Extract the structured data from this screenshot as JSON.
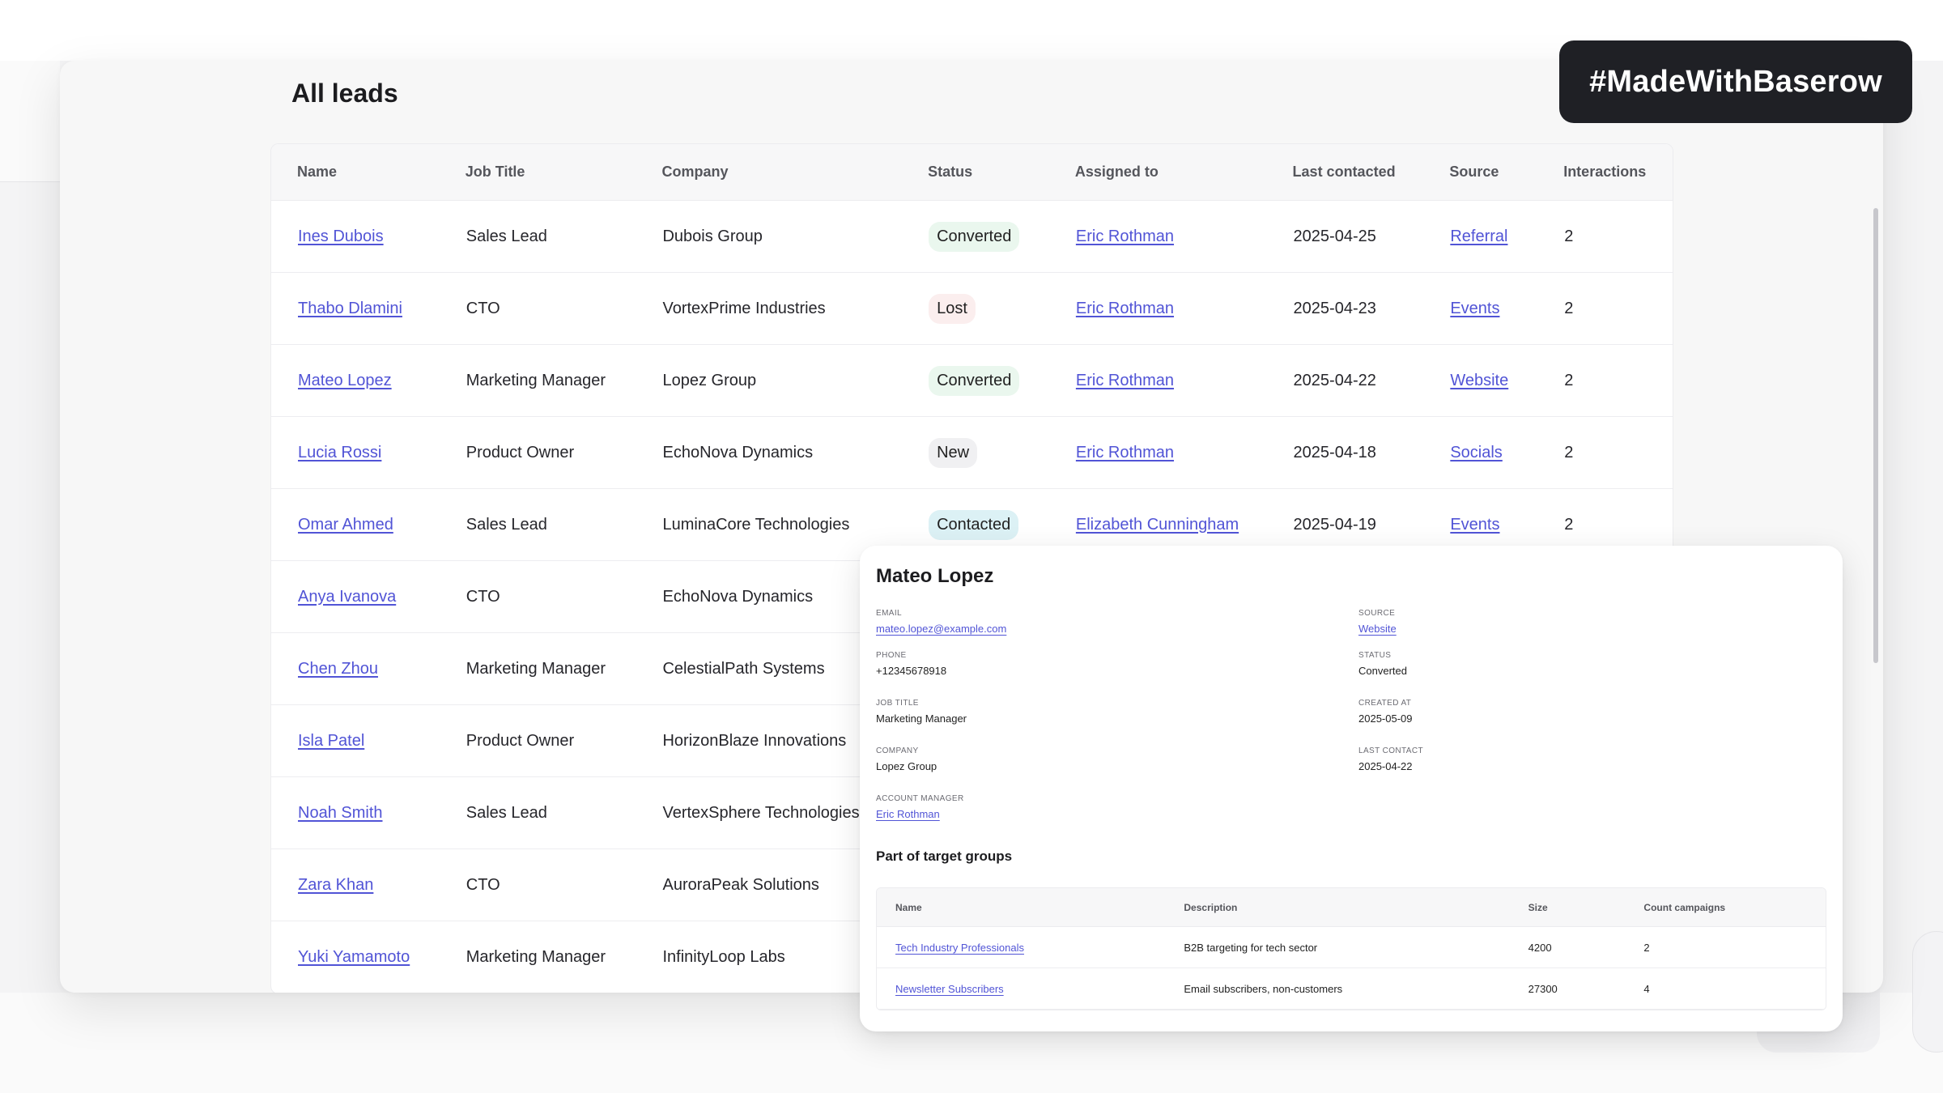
{
  "page": {
    "title": "All leads"
  },
  "badge": {
    "text": "#MadeWithBaserow"
  },
  "table": {
    "headers": [
      "Name",
      "Job Title",
      "Company",
      "Status",
      "Assigned to",
      "Last contacted",
      "Source",
      "Interactions"
    ],
    "rows": [
      {
        "name": "Ines Dubois",
        "job": "Sales Lead",
        "company": "Dubois Group",
        "status": "Converted",
        "assigned": "Eric Rothman",
        "last": "2025-04-25",
        "source": "Referral",
        "interactions": "2"
      },
      {
        "name": "Thabo Dlamini",
        "job": "CTO",
        "company": "VortexPrime Industries",
        "status": "Lost",
        "assigned": "Eric Rothman",
        "last": "2025-04-23",
        "source": "Events",
        "interactions": "2"
      },
      {
        "name": "Mateo Lopez",
        "job": "Marketing Manager",
        "company": "Lopez Group",
        "status": "Converted",
        "assigned": "Eric Rothman",
        "last": "2025-04-22",
        "source": "Website",
        "interactions": "2"
      },
      {
        "name": "Lucia Rossi",
        "job": "Product Owner",
        "company": "EchoNova Dynamics",
        "status": "New",
        "assigned": "Eric Rothman",
        "last": "2025-04-18",
        "source": "Socials",
        "interactions": "2"
      },
      {
        "name": "Omar Ahmed",
        "job": "Sales Lead",
        "company": "LuminaCore Technologies",
        "status": "Contacted",
        "assigned": "Elizabeth Cunningham",
        "last": "2025-04-19",
        "source": "Events",
        "interactions": "2"
      },
      {
        "name": "Anya Ivanova",
        "job": "CTO",
        "company": "EchoNova Dynamics"
      },
      {
        "name": "Chen Zhou",
        "job": "Marketing Manager",
        "company": "CelestialPath Systems"
      },
      {
        "name": "Isla Patel",
        "job": "Product Owner",
        "company": "HorizonBlaze Innovations"
      },
      {
        "name": "Noah Smith",
        "job": "Sales Lead",
        "company": "VertexSphere Technologies"
      },
      {
        "name": "Zara Khan",
        "job": "CTO",
        "company": "AuroraPeak Solutions"
      },
      {
        "name": "Yuki Yamamoto",
        "job": "Marketing Manager",
        "company": "InfinityLoop Labs"
      }
    ]
  },
  "status_colors": {
    "Converted": "#eaf7ee",
    "Lost": "#fbeeee",
    "New": "#f0f0f2",
    "Contacted": "#dcf1f5"
  },
  "detail": {
    "name": "Mateo Lopez",
    "email_label": "EMAIL",
    "email": "mateo.lopez@example.com",
    "phone_label": "PHONE",
    "phone": "+12345678918",
    "job_label": "JOB TITLE",
    "job": "Marketing Manager",
    "company_label": "COMPANY",
    "company": "Lopez Group",
    "manager_label": "ACCOUNT MANAGER",
    "manager": "Eric Rothman",
    "source_label": "SOURCE",
    "source": "Website",
    "status_label": "STATUS",
    "status": "Converted",
    "created_label": "CREATED AT",
    "created": "2025-05-09",
    "last_label": "LAST CONTACT",
    "last": "2025-04-22",
    "groups_title": "Part of target groups",
    "groups_headers": [
      "Name",
      "Description",
      "Size",
      "Count campaigns"
    ],
    "groups": [
      {
        "name": "Tech Industry Professionals",
        "description": "B2B targeting for tech sector",
        "size": "4200",
        "count": "2"
      },
      {
        "name": "Newsletter Subscribers",
        "description": "Email subscribers, non-customers",
        "size": "27300",
        "count": "4"
      }
    ]
  }
}
